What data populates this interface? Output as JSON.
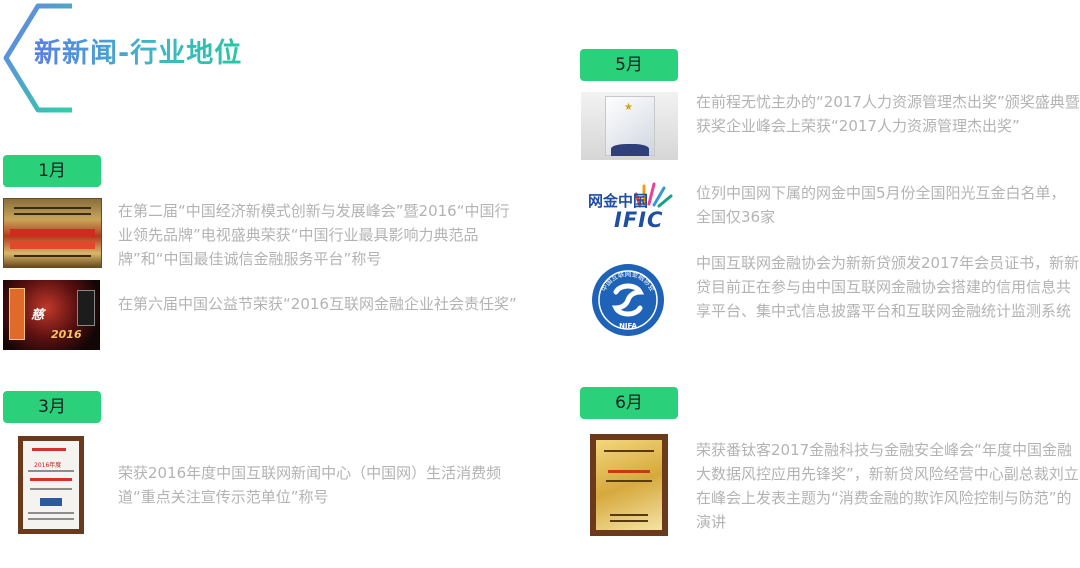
{
  "header": {
    "title": "新新闻-行业地位"
  },
  "sections": {
    "jan": {
      "month": "1月",
      "items": [
        {
          "text": "在第二届“中国经济新模式创新与发展峰会”暨2016“中国行业领先品牌”电视盛典荣获“中国行业最具影响力典范品牌”和“中国最佳诚信金融服务平台”称号"
        },
        {
          "text": "在第六届中国公益节荣获“2016互联网金融企业社会责任奖”",
          "thumb_word": "2016"
        }
      ]
    },
    "mar": {
      "month": "3月",
      "items": [
        {
          "text": "荣获2016年度中国互联网新闻中心（中国网）生活消费频道“重点关注宣传示范单位”称号",
          "thumb_label": "2016年度"
        }
      ]
    },
    "may": {
      "month": "5月",
      "items": [
        {
          "text": "在前程无忧主办的“2017人力资源管理杰出奖”颁奖盛典暨获奖企业峰会上荣获“2017人力资源管理杰出奖”"
        },
        {
          "text": "位列中国网下属的网金中国5月份全国阳光互金白名单，全国仅36家",
          "logo_cn": "网金中国",
          "logo_en": "IFIC"
        },
        {
          "text": "中国互联网金融协会为新新贷颁发2017年会员证书，新新贷目前正在参与由中国互联网金融协会搭建的信用信息共享平台、集中式信息披露平台和互联网金融统计监测系统",
          "logo_arc": "中国互联网金融协会",
          "logo_letters": "NIFA"
        }
      ]
    },
    "jun": {
      "month": "6月",
      "items": [
        {
          "text": "荣获番钛客2017金融科技与金融安全峰会“年度中国金融大数据风控应用先锋奖”，新新贷风险经营中心副总裁刘立在峰会上发表主题为“消费金融的欺诈风险控制与防范”的演讲"
        }
      ]
    }
  },
  "colors": {
    "badge": "#2bd07a",
    "title_gradient_start": "#5a7fe6",
    "title_gradient_end": "#26c6a4",
    "body_text": "#b3b3b3"
  }
}
